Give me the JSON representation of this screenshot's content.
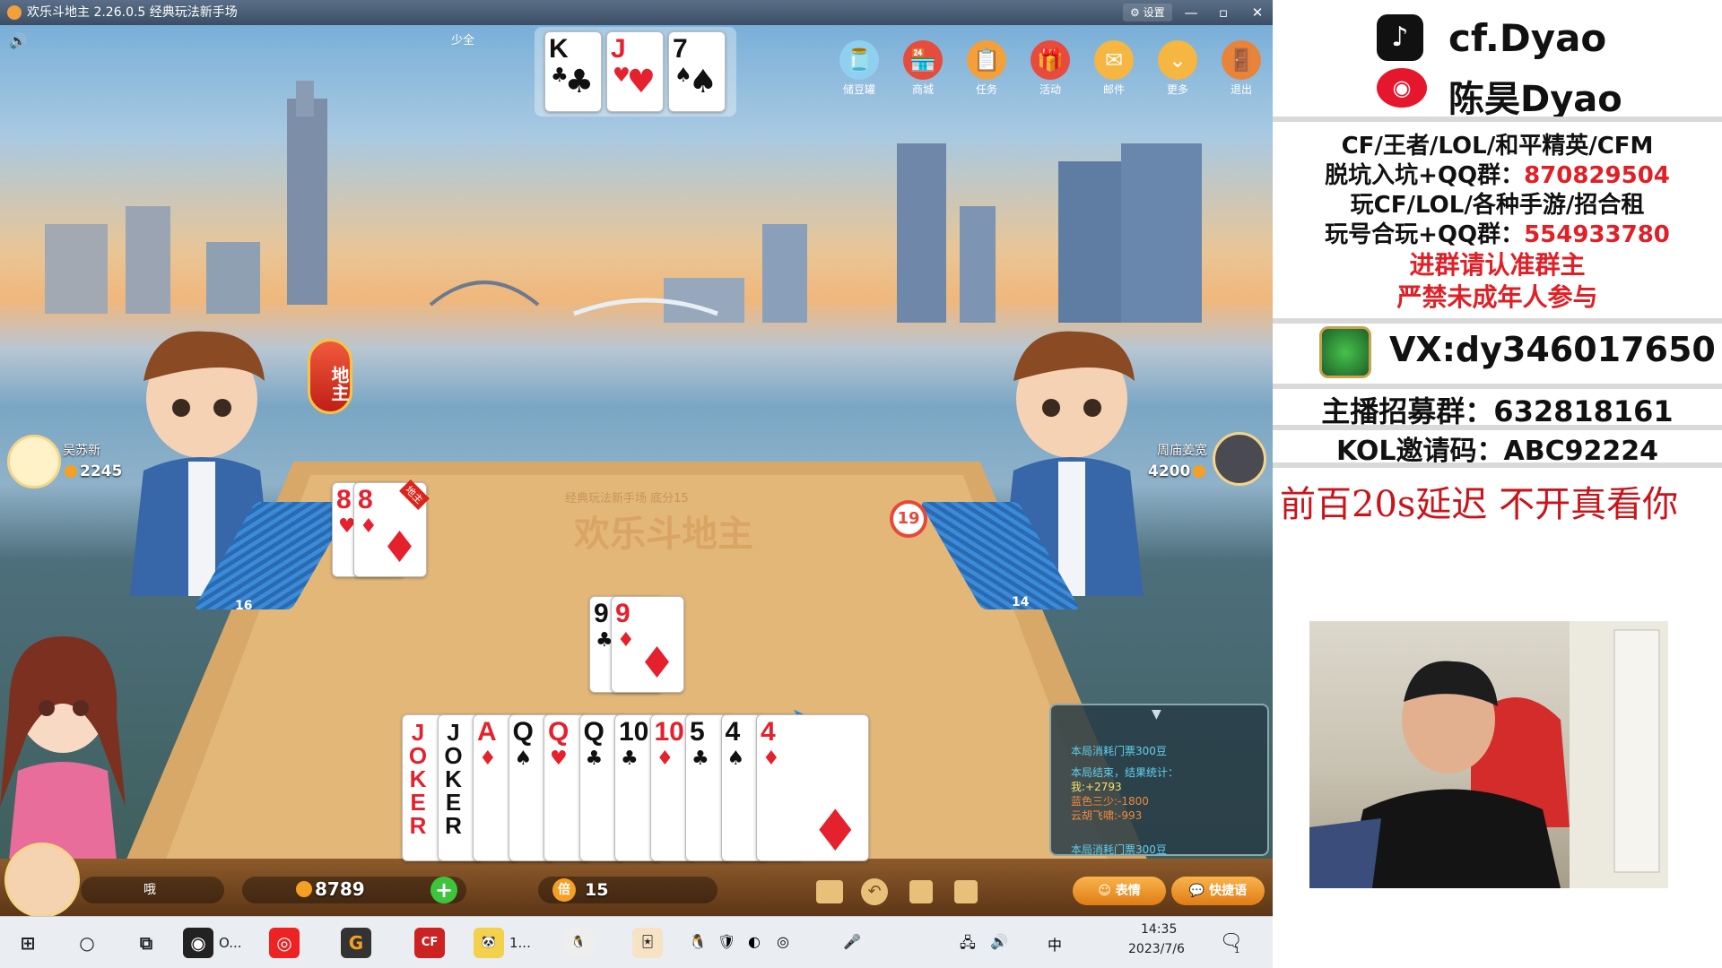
{
  "window": {
    "title": "欢乐斗地主 2.26.0.5 经典玩法新手场",
    "settings_label": "设置",
    "min": "—",
    "max": "▫",
    "close": "✕"
  },
  "top": {
    "sound_icon": "speaker-icon",
    "spectate_label": "少全",
    "bottom_cards": [
      {
        "rank": "K",
        "suit": "♣",
        "color": "blk"
      },
      {
        "rank": "J",
        "suit": "♥",
        "color": "red"
      },
      {
        "rank": "7",
        "suit": "♠",
        "color": "blk"
      }
    ]
  },
  "menu": [
    {
      "label": "储豆罐",
      "icon": "piggy-bank-icon",
      "glyph": "🫙"
    },
    {
      "label": "商城",
      "icon": "shop-icon",
      "glyph": "🏪"
    },
    {
      "label": "任务",
      "icon": "task-icon",
      "glyph": "📋"
    },
    {
      "label": "活动",
      "icon": "gift-icon",
      "glyph": "🎁"
    },
    {
      "label": "邮件",
      "icon": "mail-icon",
      "glyph": "✉"
    },
    {
      "label": "更多",
      "icon": "more-icon",
      "glyph": "⌄"
    },
    {
      "label": "退出",
      "icon": "exit-icon",
      "glyph": "🚪"
    }
  ],
  "table": {
    "caption": "经典玩法新手场 底分15",
    "logo": "欢乐斗地主",
    "timer": "19",
    "landlord_badge": "地主"
  },
  "left_player": {
    "name": "吴苏新",
    "coins": "2245",
    "cards_left": "16",
    "played": [
      {
        "rank": "8",
        "suit": "♥",
        "color": "red"
      },
      {
        "rank": "8",
        "suit": "♦",
        "color": "red",
        "tag": "地主"
      }
    ]
  },
  "right_player": {
    "name": "周庙姜宽",
    "coins": "4200",
    "cards_left": "14"
  },
  "center_played": [
    {
      "rank": "9",
      "suit": "♣",
      "color": "blk"
    },
    {
      "rank": "9",
      "suit": "♦",
      "color": "red"
    }
  ],
  "hand": [
    {
      "rank": "JOKER",
      "suit": "",
      "color": "red",
      "joker": true
    },
    {
      "rank": "JOKER",
      "suit": "",
      "color": "blk",
      "joker": true
    },
    {
      "rank": "A",
      "suit": "♦",
      "color": "red"
    },
    {
      "rank": "Q",
      "suit": "♠",
      "color": "blk"
    },
    {
      "rank": "Q",
      "suit": "♥",
      "color": "red"
    },
    {
      "rank": "Q",
      "suit": "♣",
      "color": "blk"
    },
    {
      "rank": "10",
      "suit": "♣",
      "color": "blk"
    },
    {
      "rank": "10",
      "suit": "♦",
      "color": "red"
    },
    {
      "rank": "5",
      "suit": "♣",
      "color": "blk"
    },
    {
      "rank": "4",
      "suit": "♠",
      "color": "blk"
    },
    {
      "rank": "4",
      "suit": "♦",
      "color": "red"
    }
  ],
  "me": {
    "status": "哦",
    "coins": "8789",
    "multiplier_label": "倍",
    "multiplier": "15"
  },
  "bottom_actions": {
    "emoji_label": "表情",
    "quick_chat_label": "快捷语"
  },
  "chat": {
    "lines": [
      {
        "text": "本局消耗门票300豆",
        "color": "#5fd1f0"
      },
      {
        "text": "本局结束，结果统计：",
        "color": "#5fd1f0"
      },
      {
        "text": "我:+2793",
        "color": "#f2e16b"
      },
      {
        "text": "蓝色三少:-1800",
        "color": "#f28a3a"
      },
      {
        "text": "云胡飞啸:-993",
        "color": "#f28a3a"
      },
      {
        "text": "本局消耗门票300豆",
        "color": "#5fd1f0"
      }
    ]
  },
  "taskbar": {
    "apps": [
      {
        "icon": "windows-start-icon",
        "glyph": "⊞"
      },
      {
        "icon": "search-circle-icon",
        "glyph": "○"
      },
      {
        "icon": "task-view-icon",
        "glyph": "⧉"
      },
      {
        "icon": "obs-icon",
        "glyph": "◉",
        "label": "O..."
      },
      {
        "icon": "netease-music-icon",
        "glyph": "◎"
      },
      {
        "icon": "game-launcher-icon",
        "glyph": "G"
      },
      {
        "icon": "crossfire-icon",
        "glyph": "CF"
      },
      {
        "icon": "panda-app-icon",
        "glyph": "🐼",
        "label": "1..."
      },
      {
        "icon": "qq-icon",
        "glyph": "🐧"
      },
      {
        "icon": "doudizhu-icon",
        "glyph": "🃏"
      }
    ],
    "time": "14:35",
    "date": "2023/7/6",
    "notif_count": "1"
  },
  "panel": {
    "douyin": "cf.Dyao",
    "weibo": "陈昊Dyao",
    "line1": "CF/王者/LOL/和平精英/CFM",
    "line2_prefix": "脱坑入坑+QQ群：",
    "line2_num": "870829504",
    "line3": "玩CF/LOL/各种手游/招合租",
    "line4_prefix": "玩号合玩+QQ群：",
    "line4_num": "554933780",
    "line5": "进群请认准群主",
    "line6": "严禁未成年人参与",
    "vx": "VX:dy346017650",
    "recruit": "主播招募群：632818161",
    "kol": "KOL邀请码：ABC92224",
    "notice": "前百20s延迟 不开真看你"
  }
}
